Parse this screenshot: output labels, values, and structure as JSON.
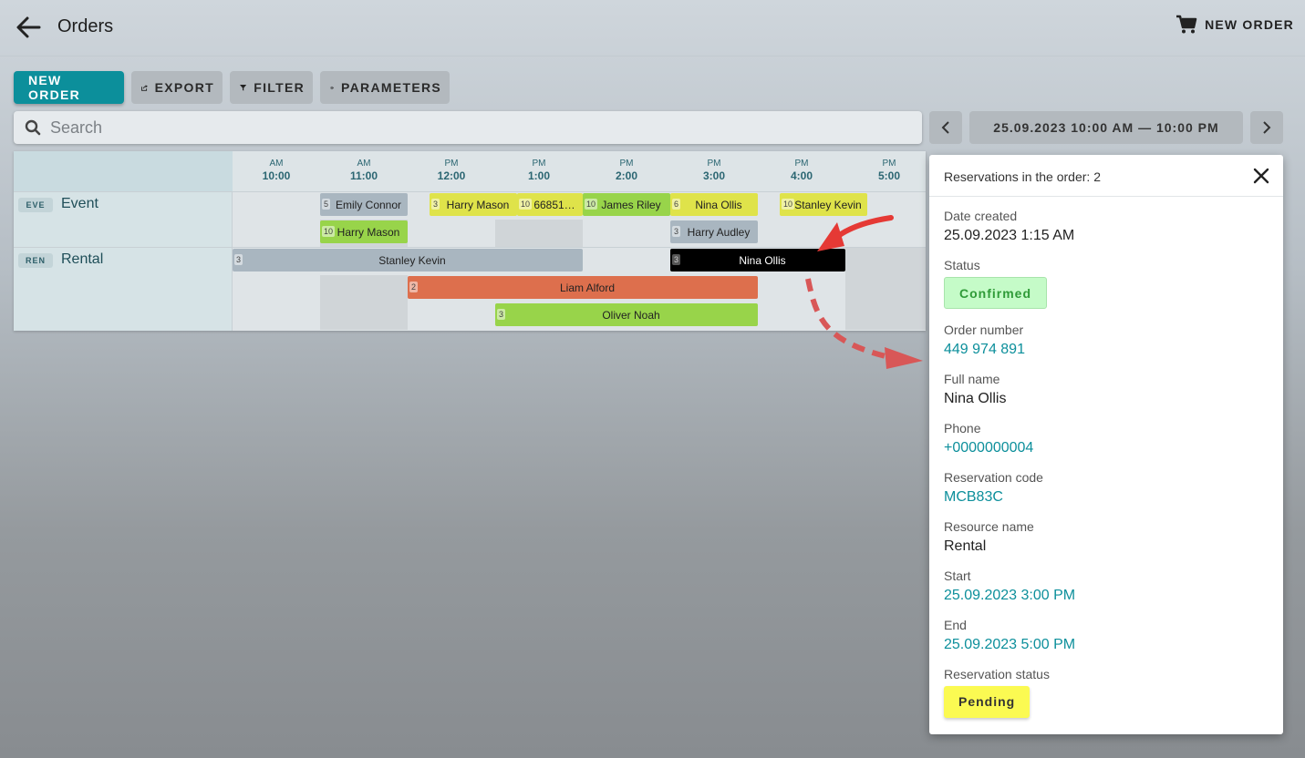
{
  "header": {
    "title": "Orders",
    "new_order_label": "NEW ORDER"
  },
  "toolbar": {
    "new_order": "NEW ORDER",
    "export": "EXPORT",
    "filter": "FILTER",
    "parameters": "PARAMETERS"
  },
  "search": {
    "placeholder": "Search",
    "value": ""
  },
  "date_range": "25.09.2023 10:00 AM — 10:00 PM",
  "timeline": {
    "hours": [
      {
        "ap": "AM",
        "hh": "10:00"
      },
      {
        "ap": "AM",
        "hh": "11:00"
      },
      {
        "ap": "PM",
        "hh": "12:00"
      },
      {
        "ap": "PM",
        "hh": "1:00"
      },
      {
        "ap": "PM",
        "hh": "2:00"
      },
      {
        "ap": "PM",
        "hh": "3:00"
      },
      {
        "ap": "PM",
        "hh": "4:00"
      },
      {
        "ap": "PM",
        "hh": "5:00"
      }
    ],
    "resources": [
      {
        "code": "EVE",
        "name": "Event"
      },
      {
        "code": "REN",
        "name": "Rental"
      }
    ],
    "reservations": [
      {
        "qty": "5",
        "name": "Emily Connor",
        "color": "#a9b6c0"
      },
      {
        "qty": "3",
        "name": "Harry Mason",
        "color": "#dfe34a"
      },
      {
        "qty": "10",
        "name": "66851…",
        "color": "#dfe34a"
      },
      {
        "qty": "10",
        "name": "James Riley",
        "color": "#98d44a"
      },
      {
        "qty": "6",
        "name": "Nina Ollis",
        "color": "#dfe34a"
      },
      {
        "qty": "10",
        "name": "Stanley Kevin",
        "color": "#dfe34a"
      },
      {
        "qty": "10",
        "name": "Harry Mason",
        "color": "#98d44a"
      },
      {
        "qty": "3",
        "name": "Harry Audley",
        "color": "#a9b6c0"
      },
      {
        "qty": "3",
        "name": "Stanley Kevin",
        "color": "#a9b6c0"
      },
      {
        "qty": "3",
        "name": "Nina Ollis",
        "color": "#000000"
      },
      {
        "qty": "2",
        "name": "Liam Alford",
        "color": "#dd6f4d"
      },
      {
        "qty": "3",
        "name": "Oliver Noah",
        "color": "#98d44a"
      }
    ]
  },
  "panel": {
    "title": "Reservations in the order: 2",
    "fields": [
      {
        "label": "Date created",
        "value": "25.09.2023 1:15 AM"
      },
      {
        "label": "Status",
        "value": "Confirmed"
      },
      {
        "label": "Order number",
        "value": "449 974 891"
      },
      {
        "label": "Full name",
        "value": "Nina Ollis"
      },
      {
        "label": "Phone",
        "value": "+0000000004"
      },
      {
        "label": "Reservation code",
        "value": "MCB83C"
      },
      {
        "label": "Resource name",
        "value": "Rental"
      },
      {
        "label": "Start",
        "value": "25.09.2023 3:00 PM"
      },
      {
        "label": "End",
        "value": "25.09.2023 5:00 PM"
      },
      {
        "label": "Reservation status",
        "value": "Pending"
      }
    ]
  },
  "colors": {
    "accent": "#0c8f9b",
    "confirmed_bg": "#c5fbc8",
    "pending_bg": "#fbfa52",
    "annotation_arrow": "#e53935"
  }
}
